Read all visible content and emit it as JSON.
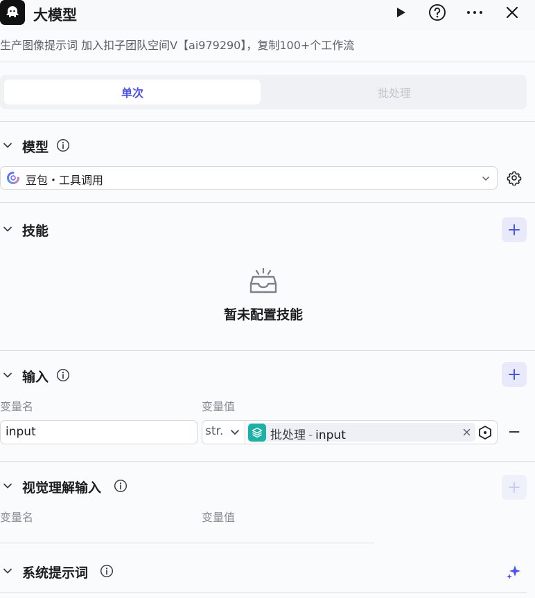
{
  "header": {
    "title": "大模型",
    "description": "生产图像提示词 加入扣子团队空间V【ai979290】，复制100+个工作流"
  },
  "tabs": [
    {
      "label": "单次",
      "active": true
    },
    {
      "label": "批处理",
      "active": false
    }
  ],
  "model_section": {
    "title": "模型",
    "selected_model": "豆包・工具调用"
  },
  "skills_section": {
    "title": "技能",
    "empty_text": "暂未配置技能"
  },
  "input_section": {
    "title": "输入",
    "col_name": "变量名",
    "col_value": "变量值",
    "rows": [
      {
        "name": "input",
        "type": "str.",
        "ref_source": "批处理",
        "ref_separator": "-",
        "ref_name": "input"
      }
    ]
  },
  "vision_section": {
    "title": "视觉理解输入",
    "col_name": "变量名",
    "col_value": "变量值"
  },
  "system_prompt_section": {
    "title": "系统提示词"
  },
  "colors": {
    "accent": "#4d53e8",
    "ref_icon": "#1db0a6",
    "ai_sparkle": "#4d53e8"
  }
}
